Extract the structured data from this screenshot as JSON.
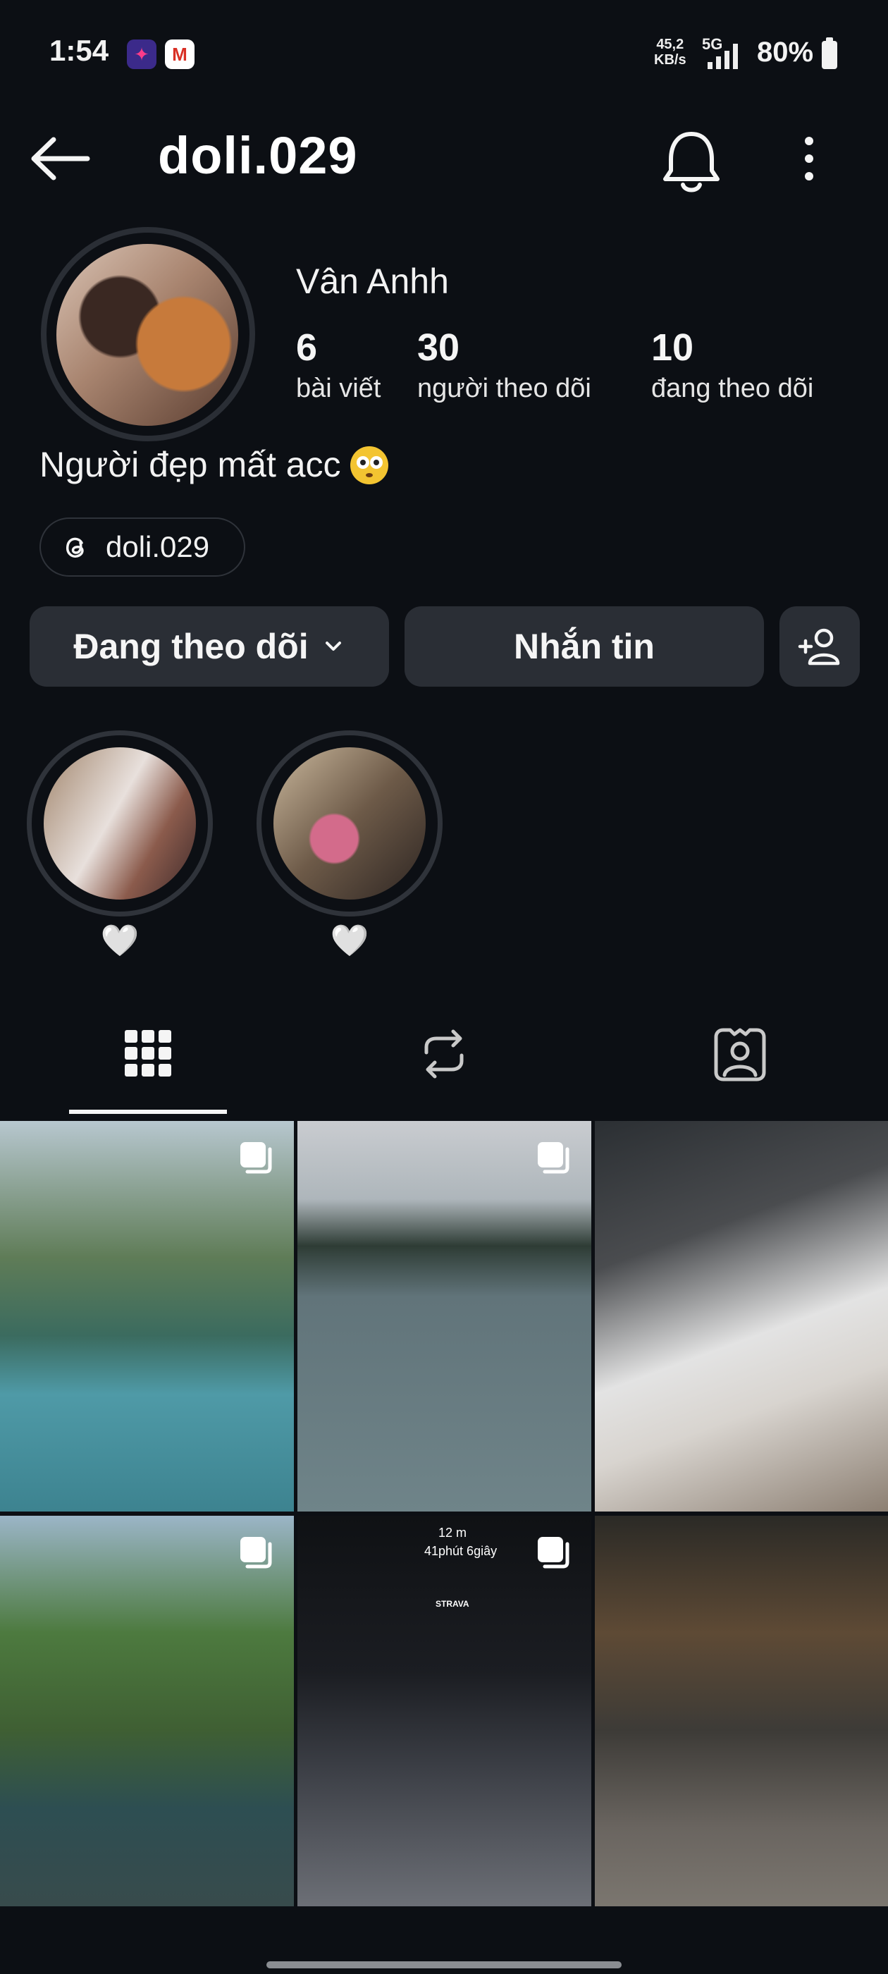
{
  "status_bar": {
    "time": "1:54",
    "net_speed_value": "45,2",
    "net_speed_unit": "KB/s",
    "network_type": "5G",
    "battery_percent": "80%"
  },
  "header": {
    "username": "doli.029"
  },
  "profile": {
    "display_name": "Vân Anhh",
    "stats": [
      {
        "value": "6",
        "label": "bài viết"
      },
      {
        "value": "30",
        "label": "người theo dõi"
      },
      {
        "value": "10",
        "label": "đang theo dõi"
      }
    ],
    "bio": "Người đẹp mất acc",
    "threads_handle": "doli.029"
  },
  "actions": {
    "follow_label": "Đang theo dõi",
    "message_label": "Nhắn tin"
  },
  "highlights": [
    {
      "label": "🤍"
    },
    {
      "label": "🤍"
    }
  ],
  "tabs": [
    "grid-icon",
    "reposts-icon",
    "tagged-icon"
  ],
  "grid": {
    "strava_distance": "12 m",
    "strava_time": "41phút 6giây",
    "strava_brand": "STRAVA"
  },
  "colors": {
    "background": "#0c0f14",
    "button": "#2a2e35",
    "text": "#f5f5f5"
  }
}
